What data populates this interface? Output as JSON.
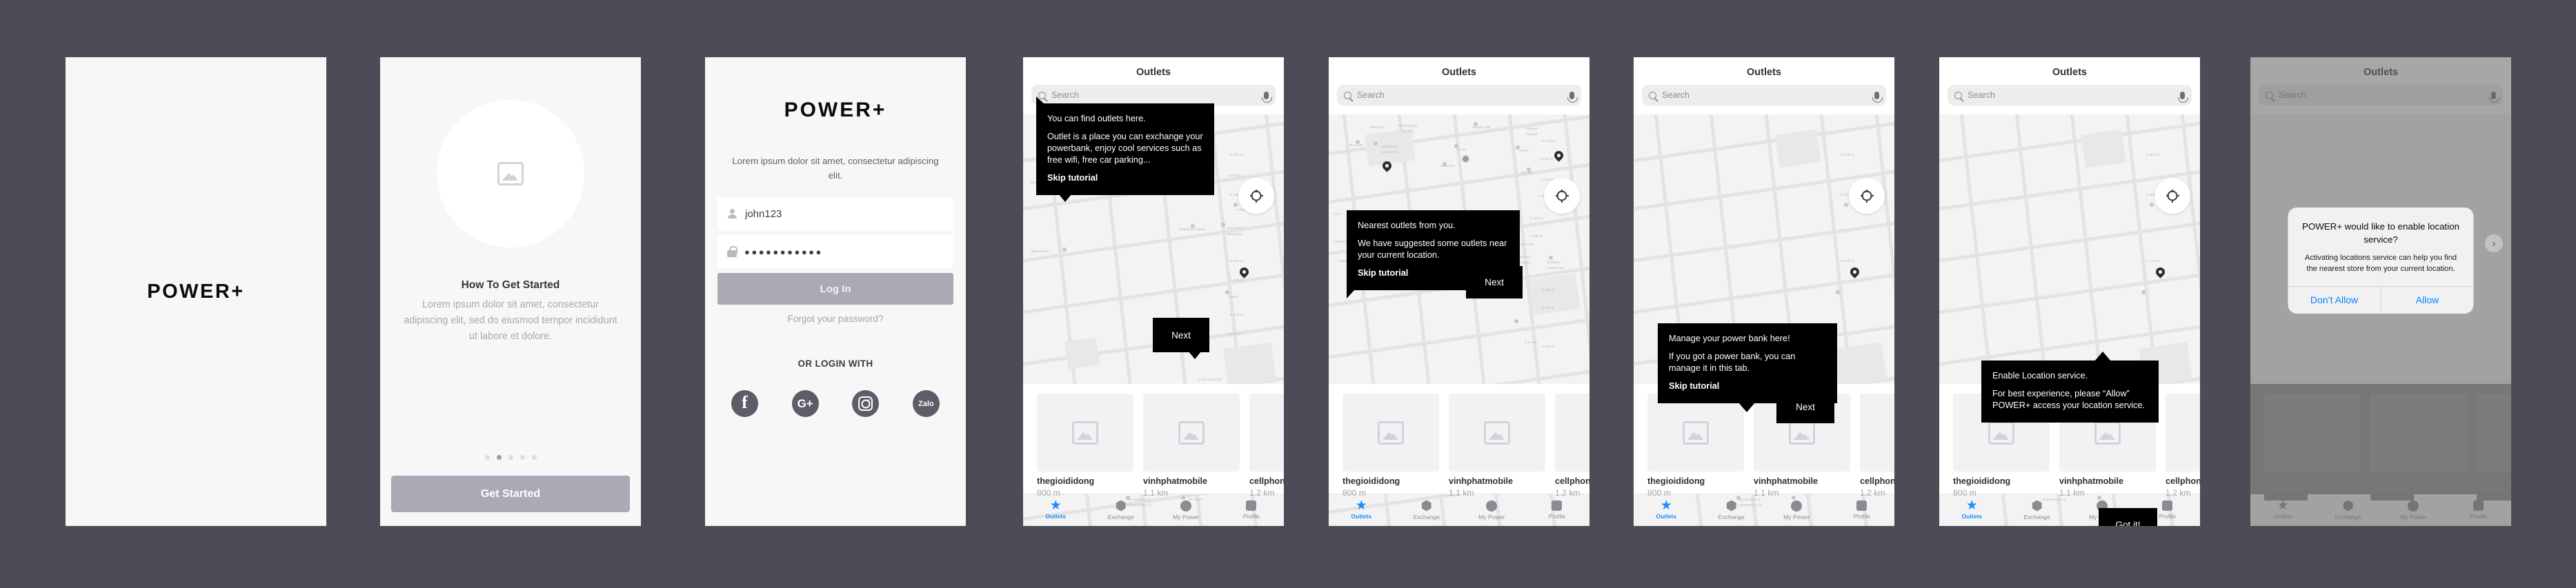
{
  "brand": {
    "name": "POWER+",
    "accent": "#1a8cff",
    "canvas_bg": "#4b4c56"
  },
  "screen1": {
    "logo": "POWER+"
  },
  "screen2": {
    "image_placeholder_icon": "image-placeholder-icon",
    "title": "How To Get Started",
    "description": "Lorem ipsum dolor sit amet, consectetur adipiscing elit, sed do eiusmod tempor incididunt ut labore et dolore.",
    "dots_total": 5,
    "dots_active_index": 1,
    "cta": "Get Started"
  },
  "screen3": {
    "logo": "POWER+",
    "subtitle": "Lorem ipsum dolor sit amet, consectetur adipiscing elit.",
    "username_value": "john123",
    "username_icon": "user-icon",
    "password_value": "●●●●●●●●●●●",
    "password_icon": "lock-icon",
    "login_button": "Log In",
    "forgot_link": "Forgot your password?",
    "or_login_with": "OR LOGIN WITH",
    "social": [
      {
        "name": "facebook",
        "glyph": "f"
      },
      {
        "name": "google-plus",
        "glyph": "G+"
      },
      {
        "name": "instagram",
        "glyph": ""
      },
      {
        "name": "zalo",
        "glyph": "Zalo"
      }
    ]
  },
  "app": {
    "title": "Outlets",
    "search_placeholder": "Search",
    "search_icon": "search-icon",
    "mic_icon": "microphone-icon",
    "locate_icon": "crosshair-locate-icon",
    "cards": [
      {
        "name": "thegioididong",
        "distance": "800 m"
      },
      {
        "name": "vinhphatmobile",
        "distance": "1.1 km"
      },
      {
        "name": "cellphones",
        "distance": "1.2 km"
      }
    ],
    "tabs": [
      {
        "label": "Outlets",
        "icon": "star-icon",
        "active": true
      },
      {
        "label": "Exchange",
        "icon": "hexagon-icon",
        "active": false
      },
      {
        "label": "My Power",
        "icon": "circle-icon",
        "active": false
      },
      {
        "label": "Profile",
        "icon": "square-icon",
        "active": false
      }
    ]
  },
  "screen4": {
    "tip": {
      "line1": "You can find outlets here.",
      "line2": "Outlet is a place you can exchange your powerbank, enjoy cool services such as free wifi, free car parking...",
      "skip": "Skip tutorial"
    },
    "next": "Next"
  },
  "screen5": {
    "tip": {
      "line1": "Nearest outlets from you.",
      "line2": "We have suggested some outlets near your current location.",
      "skip": "Skip tutorial"
    },
    "next": "Next"
  },
  "screen6": {
    "tip": {
      "line1": "Manage your power bank here!",
      "line2": "If you got a power bank, you can manage it in this tab.",
      "skip": "Skip tutorial"
    },
    "next": "Next"
  },
  "screen7": {
    "tip": {
      "line1": "Enable Location service.",
      "line2": "For best experience, please “Allow” POWER+ access your location service."
    },
    "got_it": "Got it!"
  },
  "screen8": {
    "dialog": {
      "title": "POWER+ would like to enable location service?",
      "body": "Activating locations service can help you find the nearest store from your current location.",
      "deny": "Don’t Allow",
      "allow": "Allow"
    },
    "chevron_icon": "chevron-right-icon"
  }
}
